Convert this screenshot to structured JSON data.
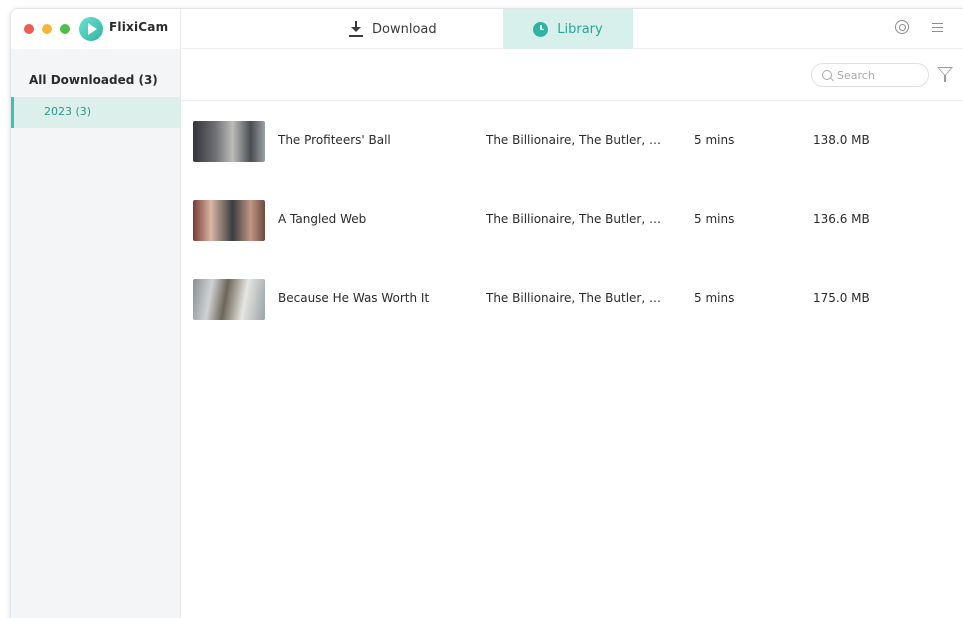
{
  "app": {
    "name": "FlixiCam"
  },
  "nav": {
    "download_label": "Download",
    "library_label": "Library"
  },
  "sidebar": {
    "heading": "All Downloaded (3)",
    "items": [
      {
        "label": "2023 (3)"
      }
    ]
  },
  "search": {
    "placeholder": "Search",
    "value": ""
  },
  "list": {
    "rows": [
      {
        "title": "The Profiteers' Ball",
        "series": "The Billionaire, The Butler, a...",
        "duration": "5 mins",
        "size": "138.0 MB"
      },
      {
        "title": "A Tangled Web",
        "series": "The Billionaire, The Butler, a...",
        "duration": "5 mins",
        "size": "136.6 MB"
      },
      {
        "title": "Because He Was Worth It",
        "series": "The Billionaire, The Butler, a...",
        "duration": "5 mins",
        "size": "175.0 MB"
      }
    ]
  },
  "colors": {
    "accent": "#2fb3a2",
    "accent_light": "#d7f0ec",
    "sidebar_bg": "#f4f5f6"
  },
  "icons": [
    "close-dot",
    "minimize-dot",
    "zoom-dot",
    "app-logo",
    "download-icon",
    "clock-icon",
    "gear-icon",
    "menu-icon",
    "search-icon",
    "filter-icon"
  ]
}
